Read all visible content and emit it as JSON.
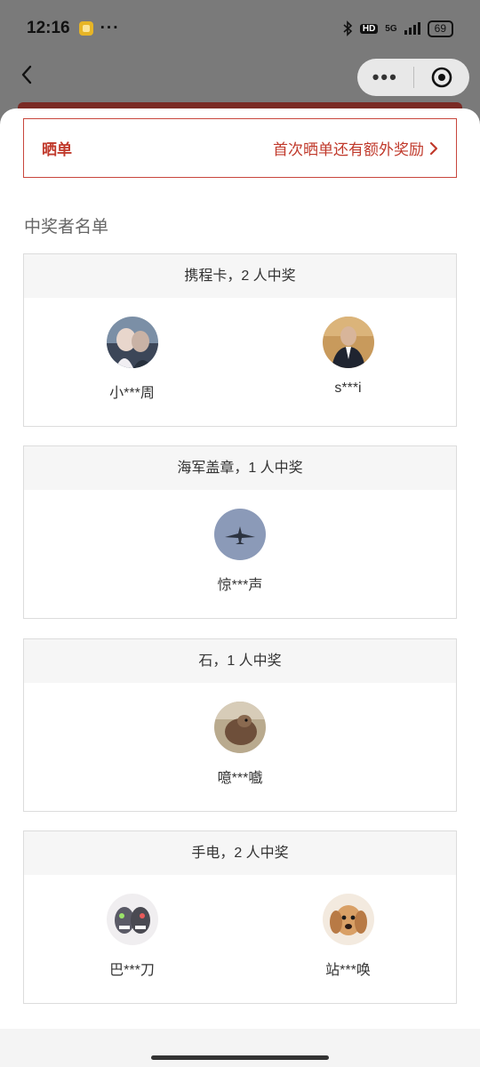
{
  "status": {
    "time": "12:16",
    "dots": "···",
    "hd": "HD",
    "net": "5G",
    "battery": "69"
  },
  "nav": {
    "more": "•••"
  },
  "share": {
    "title": "晒单",
    "extra": "首次晒单还有额外奖励"
  },
  "section_title": "中奖者名单",
  "prizes": [
    {
      "header": "携程卡，2 人中奖",
      "winners": [
        {
          "name": "小***周",
          "avatar": "couple-photo-avatar"
        },
        {
          "name": "s***i",
          "avatar": "man-in-suit-avatar"
        }
      ]
    },
    {
      "header": "海军盖章，1 人中奖",
      "winners": [
        {
          "name": "惊***声",
          "avatar": "fighter-jet-avatar"
        }
      ]
    },
    {
      "header": "石，1 人中奖",
      "winners": [
        {
          "name": "噫***嚱",
          "avatar": "animal-photo-avatar"
        }
      ]
    },
    {
      "header": "手电，2 人中奖",
      "winners": [
        {
          "name": "巴***刀",
          "avatar": "cartoon-monster-avatar"
        },
        {
          "name": "站***唤",
          "avatar": "puppy-avatar"
        }
      ]
    }
  ]
}
